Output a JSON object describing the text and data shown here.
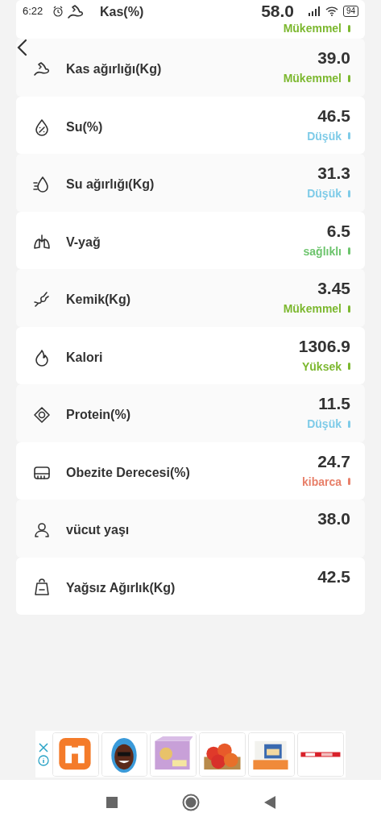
{
  "status_bar": {
    "time": "6:22",
    "battery": "94"
  },
  "metrics": [
    {
      "label": "Kas(%)",
      "value": "58.0",
      "status": "Mükemmel",
      "color": "#7cb82f"
    },
    {
      "label": "Kas ağırlığı(Kg)",
      "value": "39.0",
      "status": "Mükemmel",
      "color": "#7cb82f"
    },
    {
      "label": "Su(%)",
      "value": "46.5",
      "status": "Düşük",
      "color": "#7ecbe8"
    },
    {
      "label": "Su ağırlığı(Kg)",
      "value": "31.3",
      "status": "Düşük",
      "color": "#7ecbe8"
    },
    {
      "label": "V-yağ",
      "value": "6.5",
      "status": "sağlıklı",
      "color": "#6cc46c"
    },
    {
      "label": "Kemik(Kg)",
      "value": "3.45",
      "status": "Mükemmel",
      "color": "#7cb82f"
    },
    {
      "label": "Kalori",
      "value": "1306.9",
      "status": "Yüksek",
      "color": "#7cb82f"
    },
    {
      "label": "Protein(%)",
      "value": "11.5",
      "status": "Düşük",
      "color": "#7ecbe8"
    },
    {
      "label": "Obezite Derecesi(%)",
      "value": "24.7",
      "status": "kibarca",
      "color": "#e8806a"
    },
    {
      "label": "vücut yaşı",
      "value": "38.0"
    },
    {
      "label": "Yağsız Ağırlık(Kg)",
      "value": "42.5"
    }
  ]
}
